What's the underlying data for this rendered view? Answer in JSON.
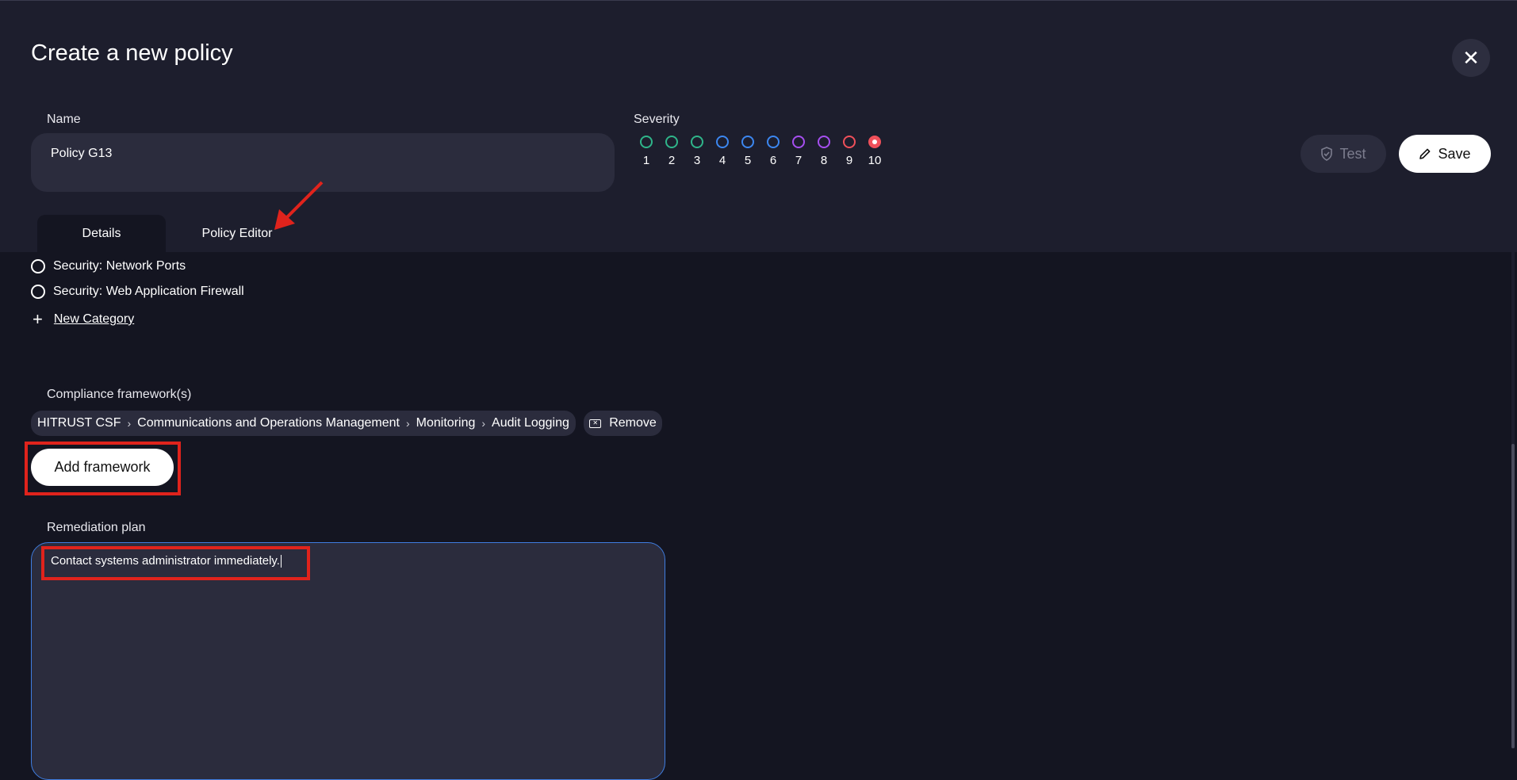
{
  "modal": {
    "title": "Create a new policy",
    "close_icon": "close-icon"
  },
  "name_field": {
    "label": "Name",
    "value": "Policy G13"
  },
  "severity": {
    "label": "Severity",
    "selected": "10",
    "levels": [
      {
        "num": "1",
        "color": "#2fb58a"
      },
      {
        "num": "2",
        "color": "#2fb58a"
      },
      {
        "num": "3",
        "color": "#2fb58a"
      },
      {
        "num": "4",
        "color": "#3c87f0"
      },
      {
        "num": "5",
        "color": "#3c87f0"
      },
      {
        "num": "6",
        "color": "#3c87f0"
      },
      {
        "num": "7",
        "color": "#a64ff0"
      },
      {
        "num": "8",
        "color": "#a64ff0"
      },
      {
        "num": "9",
        "color": "#f0505a"
      },
      {
        "num": "10",
        "color": "#f0505a"
      }
    ]
  },
  "actions": {
    "test_label": "Test",
    "save_label": "Save"
  },
  "tabs": {
    "details": "Details",
    "policy_editor": "Policy Editor"
  },
  "categories": {
    "items": [
      "Security: Network Ports",
      "Security: Web Application Firewall"
    ],
    "new_category": "New Category"
  },
  "compliance": {
    "label": "Compliance framework(s)",
    "path": [
      "HITRUST CSF",
      "Communications and Operations Management",
      "Monitoring",
      "Audit Logging"
    ],
    "remove_label": "Remove",
    "add_label": "Add framework"
  },
  "remediation": {
    "label": "Remediation plan",
    "value": "Contact systems administrator immediately."
  },
  "colors": {
    "annotation_red": "#e0231c",
    "focus_blue": "#3f7de0"
  }
}
